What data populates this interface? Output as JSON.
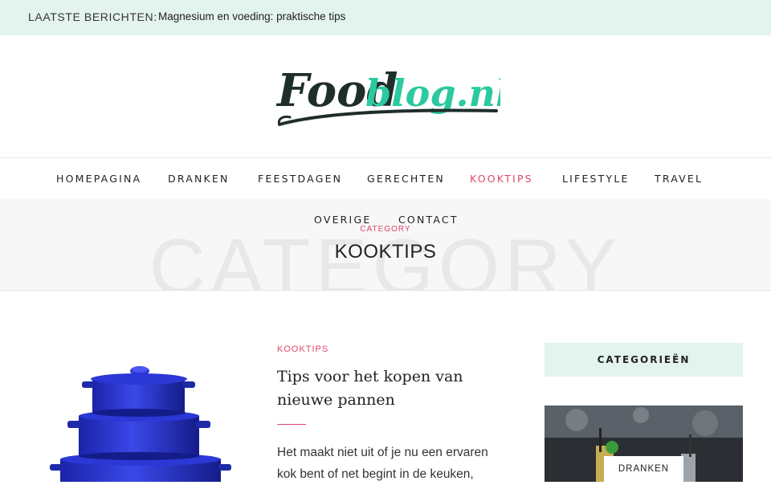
{
  "topbar": {
    "label": "LAATSTE BERICHTEN:",
    "latest_post": "Magnesium en voeding: praktische tips"
  },
  "logo": {
    "part1": "Food",
    "part2": "blog.nl",
    "color_dark": "#1f2e2a",
    "color_accent": "#2cc9a0"
  },
  "nav": {
    "items": [
      "HOMEPAGINA",
      "DRANKEN",
      "FEESTDAGEN",
      "GERECHTEN",
      "KOOKTIPS",
      "LIFESTYLE",
      "TRAVEL"
    ],
    "items_row2": [
      "OVERIGE",
      "CONTACT"
    ],
    "active": "KOOKTIPS"
  },
  "category_header": {
    "ghost_text": "CATEGORY",
    "label": "CATEGORY",
    "title": "KOOKTIPS"
  },
  "post": {
    "category": "KOOKTIPS",
    "title": "Tips voor het kopen van nieuwe pannen",
    "excerpt_line1": "Het maakt niet uit of je nu een ervaren",
    "excerpt_line2": "kok bent of net begint in de keuken,"
  },
  "sidebar": {
    "widget_title": "CATEGORIEËN",
    "category_badge": "DRANKEN"
  },
  "colors": {
    "accent_pink": "#e0466b",
    "mint": "#e3f3ee"
  }
}
